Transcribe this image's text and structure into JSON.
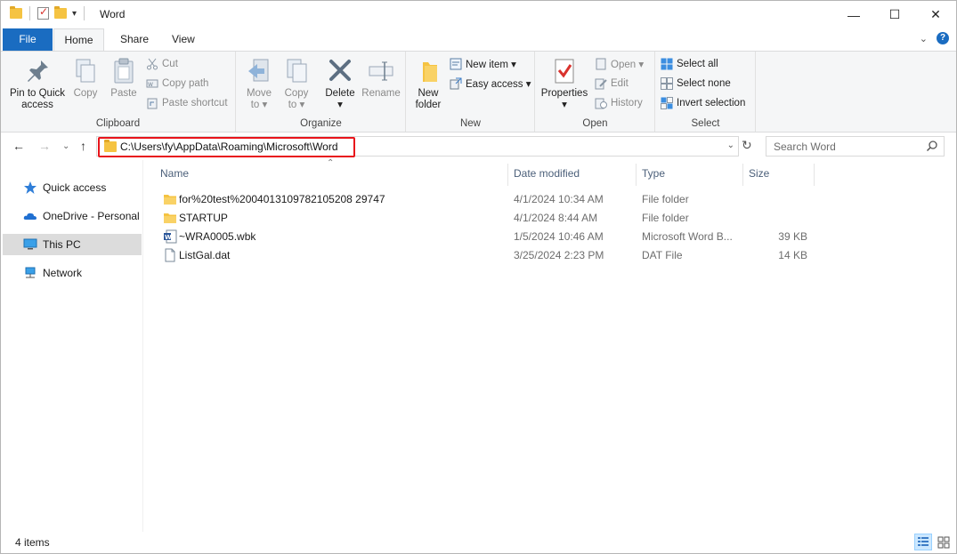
{
  "window": {
    "title": "Word",
    "controls": {
      "minimize": "—",
      "maximize": "☐",
      "close": "✕"
    }
  },
  "tabs": {
    "file": "File",
    "home": "Home",
    "share": "Share",
    "view": "View",
    "help": "?"
  },
  "ribbon": {
    "clipboard": {
      "label": "Clipboard",
      "pin": "Pin to Quick access",
      "pin_line1": "Pin to Quick",
      "pin_line2": "access",
      "copy": "Copy",
      "paste": "Paste",
      "cut": "Cut",
      "copy_path": "Copy path",
      "paste_shortcut": "Paste shortcut"
    },
    "organize": {
      "label": "Organize",
      "move_to_line1": "Move",
      "move_to_line2": "to ▾",
      "copy_to_line1": "Copy",
      "copy_to_line2": "to ▾",
      "delete": "Delete",
      "delete_arrow": "▾",
      "rename": "Rename"
    },
    "new": {
      "label": "New",
      "new_folder_line1": "New",
      "new_folder_line2": "folder",
      "new_item": "New item ▾",
      "easy_access": "Easy access ▾"
    },
    "open": {
      "label": "Open",
      "properties": "Properties",
      "properties_arrow": "▾",
      "open": "Open ▾",
      "edit": "Edit",
      "history": "History"
    },
    "select": {
      "label": "Select",
      "select_all": "Select all",
      "select_none": "Select none",
      "invert_selection": "Invert selection"
    }
  },
  "address": {
    "path": "C:\\Users\\fy\\AppData\\Roaming\\Microsoft\\Word",
    "search_placeholder": "Search Word"
  },
  "nav_pane": {
    "items": [
      {
        "label": "Quick access",
        "icon": "star-icon"
      },
      {
        "label": "OneDrive - Personal",
        "icon": "cloud-icon"
      },
      {
        "label": "This PC",
        "icon": "monitor-icon",
        "selected": true
      },
      {
        "label": "Network",
        "icon": "network-icon"
      }
    ]
  },
  "columns": {
    "name": "Name",
    "date_modified": "Date modified",
    "type": "Type",
    "size": "Size"
  },
  "files": [
    {
      "name": "for%20test%2004013109782105208 29747",
      "display": "for%20test%20040131097821052082 9747",
      "date": "4/1/2024 10:34 AM",
      "type": "File folder",
      "size": "",
      "icon": "folder-icon"
    },
    {
      "name": "STARTUP",
      "date": "4/1/2024 8:44 AM",
      "type": "File folder",
      "size": "",
      "icon": "folder-icon"
    },
    {
      "name": "~WRA0005.wbk",
      "date": "1/5/2024 10:46 AM",
      "type": "Microsoft Word B...",
      "size": "39 KB",
      "icon": "word-doc-icon"
    },
    {
      "name": "ListGal.dat",
      "date": "3/25/2024 2:23 PM",
      "type": "DAT File",
      "size": "14 KB",
      "icon": "file-icon"
    }
  ],
  "status": {
    "item_count": "4 items"
  },
  "colors": {
    "file_tab": "#1a6cc1",
    "highlight_border": "#e8141b",
    "folder": "#f5c342",
    "selected_nav": "#dcdcdc"
  }
}
